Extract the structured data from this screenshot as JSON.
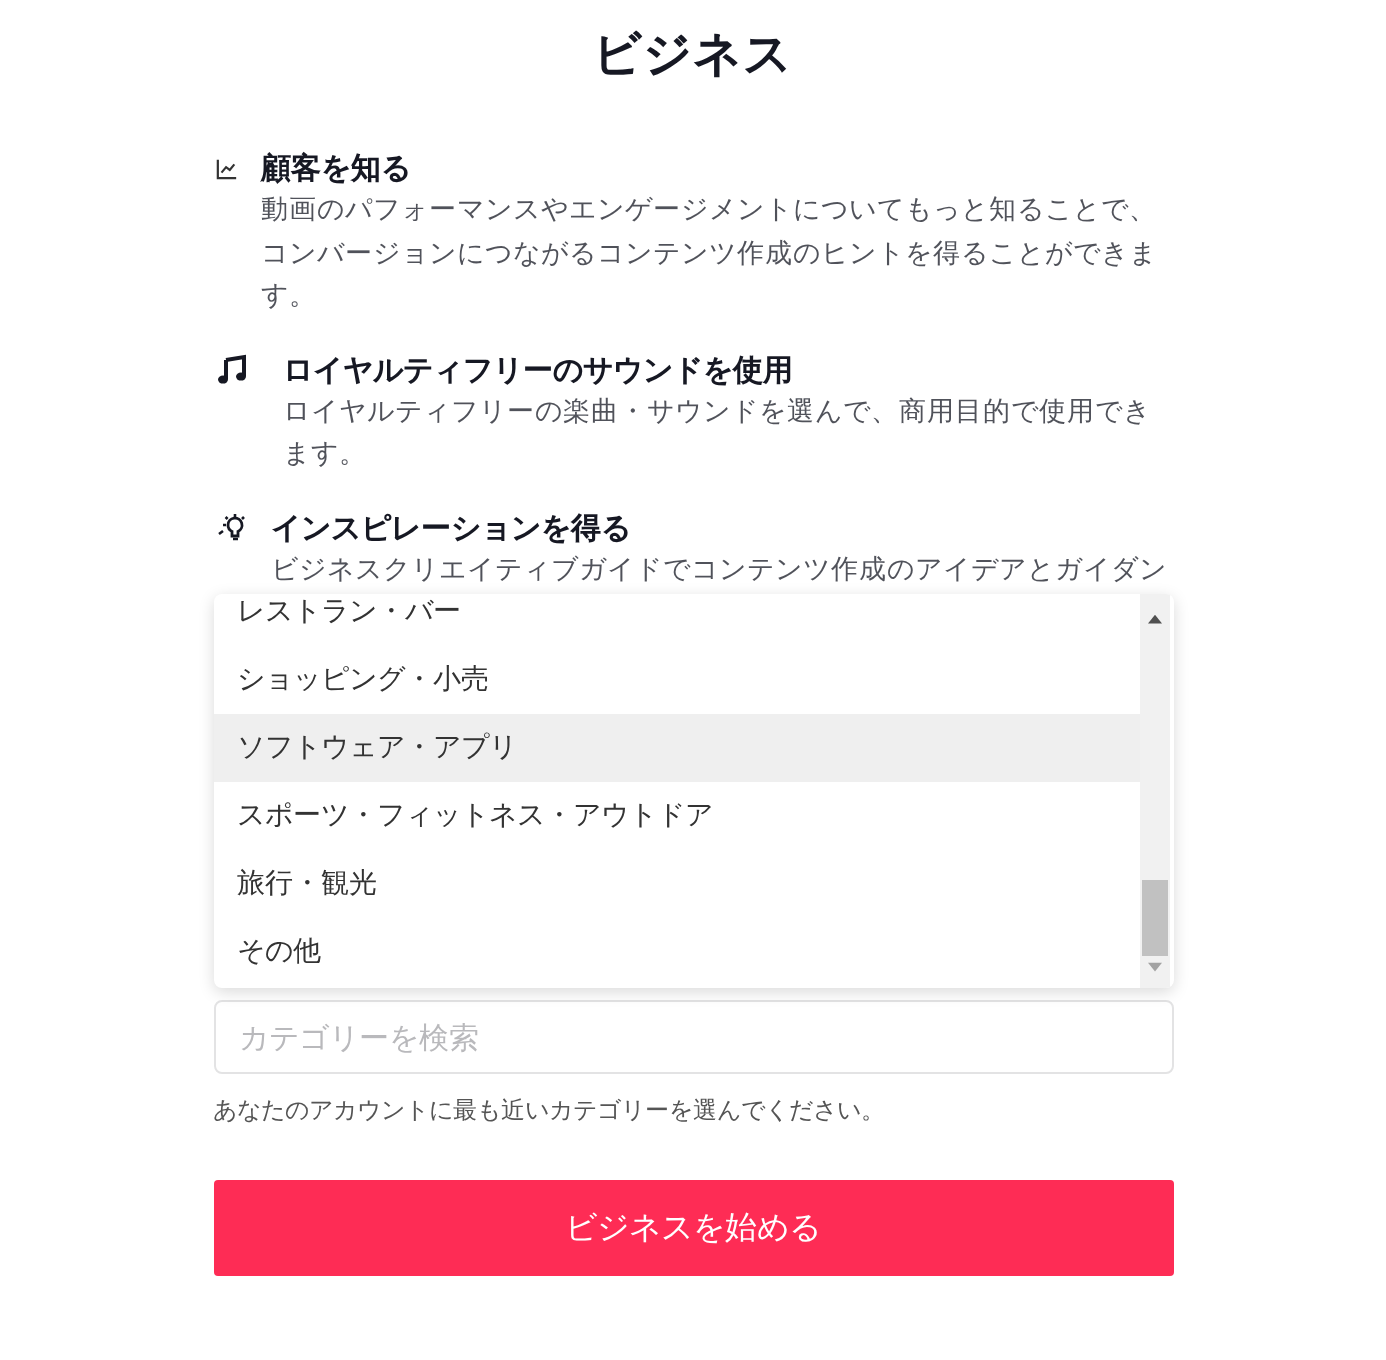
{
  "title": "ビジネス",
  "features": [
    {
      "kind": "chart",
      "heading": "顧客を知る",
      "description": "動画のパフォーマンスやエンゲージメントについてもっと知ることで、コンバージョンにつながるコンテンツ作成のヒントを得ることができます。"
    },
    {
      "kind": "music",
      "heading": "ロイヤルティフリーのサウンドを使用",
      "description": "ロイヤルティフリーの楽曲・サウンドを選んで、商用目的で使用できます。"
    },
    {
      "kind": "bulb",
      "heading": "インスピレーションを得る",
      "description": "ビジネスクリエイティブガイドでコンテンツ作成のアイデアとガイダン"
    }
  ],
  "category_list": [
    {
      "label": "レストラン・バー",
      "selected": false
    },
    {
      "label": "ショッピング・小売",
      "selected": false
    },
    {
      "label": "ソフトウェア・アプリ",
      "selected": true
    },
    {
      "label": "スポーツ・フィットネス・アウトドア",
      "selected": false
    },
    {
      "label": "旅行・観光",
      "selected": false
    },
    {
      "label": "その他",
      "selected": false
    }
  ],
  "search": {
    "placeholder": "カテゴリーを検索"
  },
  "hint": "あなたのアカウントに最も近いカテゴリーを選んでください。",
  "submit_button": "ビジネスを始める"
}
